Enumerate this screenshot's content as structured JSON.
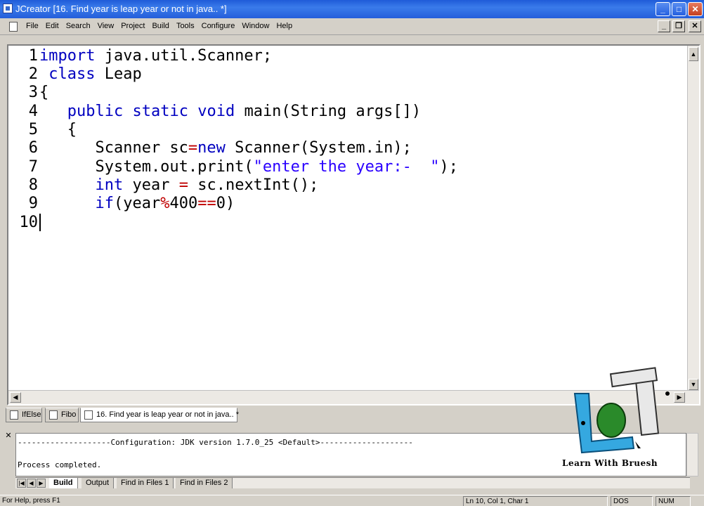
{
  "window": {
    "title": "JCreator  [16. Find year is leap year or not in java.. *]",
    "controls": {
      "minimize": "_",
      "maximize": "□",
      "close": "✕"
    }
  },
  "menu": {
    "items": [
      "File",
      "Edit",
      "Search",
      "View",
      "Project",
      "Build",
      "Tools",
      "Configure",
      "Window",
      "Help"
    ],
    "doc_controls": {
      "minimize": "_",
      "restore": "❐",
      "close": "✕"
    }
  },
  "editor": {
    "line_numbers": [
      "1",
      "2",
      "3",
      "4",
      "5",
      "6",
      "7",
      "8",
      "9",
      "10"
    ],
    "lines": [
      "import java.util.Scanner;",
      " class Leap",
      "{",
      "   public static void main(String args[])",
      "   {",
      "      Scanner sc=new Scanner(System.in);",
      "      System.out.print(\"enter the year:-  \");",
      "      int year = sc.nextInt();",
      "      if(year%400==0)",
      ""
    ],
    "current_line": 10
  },
  "doc_tabs": [
    {
      "label": "IfElse",
      "active": false
    },
    {
      "label": "Fibo",
      "active": false
    },
    {
      "label": "16. Find year is leap year or not in java.. *",
      "active": true
    }
  ],
  "output": {
    "lines": [
      "--------------------Configuration: JDK version 1.7.0_25 <Default>--------------------",
      "",
      "Process completed."
    ],
    "tabs": [
      {
        "label": "Build",
        "active": true
      },
      {
        "label": "Output",
        "active": false
      },
      {
        "label": "Find in Files 1",
        "active": false
      },
      {
        "label": "Find in Files 2",
        "active": false
      }
    ]
  },
  "statusbar": {
    "help": "For Help, press F1",
    "position": "Ln 10, Col 1, Char 1",
    "format": "DOS",
    "numlock": "NUM"
  },
  "watermark": {
    "text": "Learn With Bruesh"
  },
  "colors": {
    "titlebar": "#245edb",
    "keyword": "#0000c0",
    "string": "#2a00ff",
    "operator": "#c00000",
    "chrome": "#d4d0c8"
  }
}
